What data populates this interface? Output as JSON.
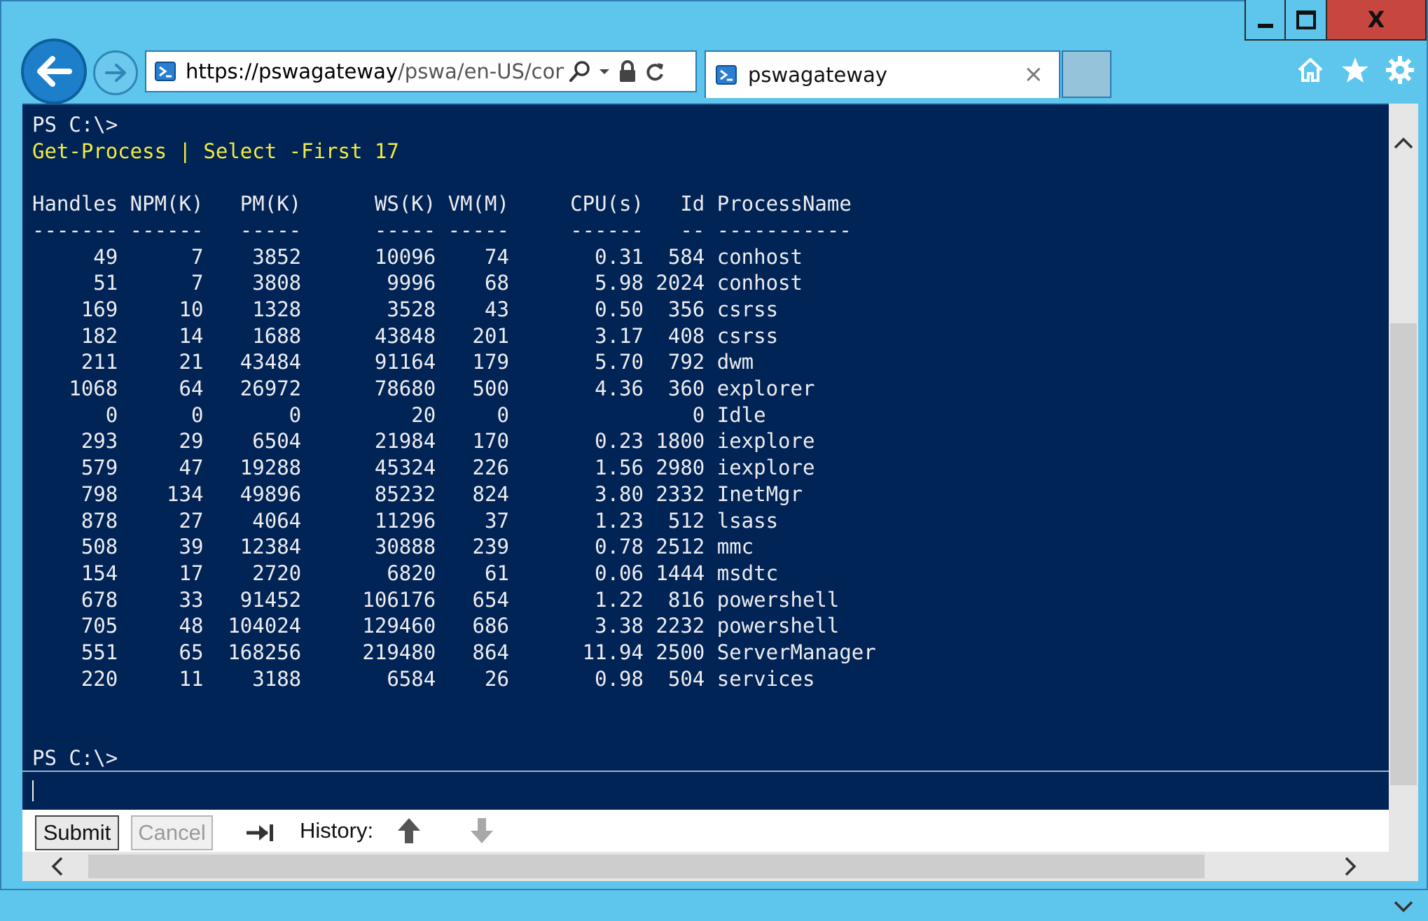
{
  "window": {
    "min_icon": "minimize-icon",
    "max_icon": "maximize-icon",
    "close_label": "X"
  },
  "nav": {
    "back_icon": "back-arrow-icon",
    "forward_icon": "forward-arrow-icon"
  },
  "address": {
    "url_proto": "https://",
    "url_host": "pswagateway",
    "url_rest": "/pswa/en-US/console"
  },
  "tab": {
    "title": "pswagateway",
    "close_label": "×"
  },
  "toolbar": {
    "icons": [
      "home-icon",
      "favorites-star-icon",
      "settings-gear-icon"
    ]
  },
  "console": {
    "prompt_top": "PS C:\\>",
    "command": "Get-Process | Select -First 17",
    "table": {
      "headers": [
        "Handles",
        "NPM(K)",
        "PM(K)",
        "WS(K)",
        "VM(M)",
        "CPU(s)",
        "Id",
        "ProcessName"
      ],
      "rows": [
        [
          "49",
          "7",
          "3852",
          "10096",
          "74",
          "0.31",
          "584",
          "conhost"
        ],
        [
          "51",
          "7",
          "3808",
          "9996",
          "68",
          "5.98",
          "2024",
          "conhost"
        ],
        [
          "169",
          "10",
          "1328",
          "3528",
          "43",
          "0.50",
          "356",
          "csrss"
        ],
        [
          "182",
          "14",
          "1688",
          "43848",
          "201",
          "3.17",
          "408",
          "csrss"
        ],
        [
          "211",
          "21",
          "43484",
          "91164",
          "179",
          "5.70",
          "792",
          "dwm"
        ],
        [
          "1068",
          "64",
          "26972",
          "78680",
          "500",
          "4.36",
          "360",
          "explorer"
        ],
        [
          "0",
          "0",
          "0",
          "20",
          "0",
          "",
          "0",
          "Idle"
        ],
        [
          "293",
          "29",
          "6504",
          "21984",
          "170",
          "0.23",
          "1800",
          "iexplore"
        ],
        [
          "579",
          "47",
          "19288",
          "45324",
          "226",
          "1.56",
          "2980",
          "iexplore"
        ],
        [
          "798",
          "134",
          "49896",
          "85232",
          "824",
          "3.80",
          "2332",
          "InetMgr"
        ],
        [
          "878",
          "27",
          "4064",
          "11296",
          "37",
          "1.23",
          "512",
          "lsass"
        ],
        [
          "508",
          "39",
          "12384",
          "30888",
          "239",
          "0.78",
          "2512",
          "mmc"
        ],
        [
          "154",
          "17",
          "2720",
          "6820",
          "61",
          "0.06",
          "1444",
          "msdtc"
        ],
        [
          "678",
          "33",
          "91452",
          "106176",
          "654",
          "1.22",
          "816",
          "powershell"
        ],
        [
          "705",
          "48",
          "104024",
          "129460",
          "686",
          "3.38",
          "2232",
          "powershell"
        ],
        [
          "551",
          "65",
          "168256",
          "219480",
          "864",
          "11.94",
          "2500",
          "ServerManager"
        ],
        [
          "220",
          "11",
          "3188",
          "6584",
          "26",
          "0.98",
          "504",
          "services"
        ]
      ]
    },
    "prompt_bottom": "PS C:\\>",
    "input_value": ""
  },
  "controls": {
    "submit_label": "Submit",
    "cancel_label": "Cancel",
    "history_label": "History:"
  },
  "colors": {
    "console_bg": "#012456",
    "console_fg": "#eeedf0",
    "command_fg": "#f2ec3d",
    "chrome_bg": "#5ec6ec",
    "close_btn": "#c7463f"
  }
}
